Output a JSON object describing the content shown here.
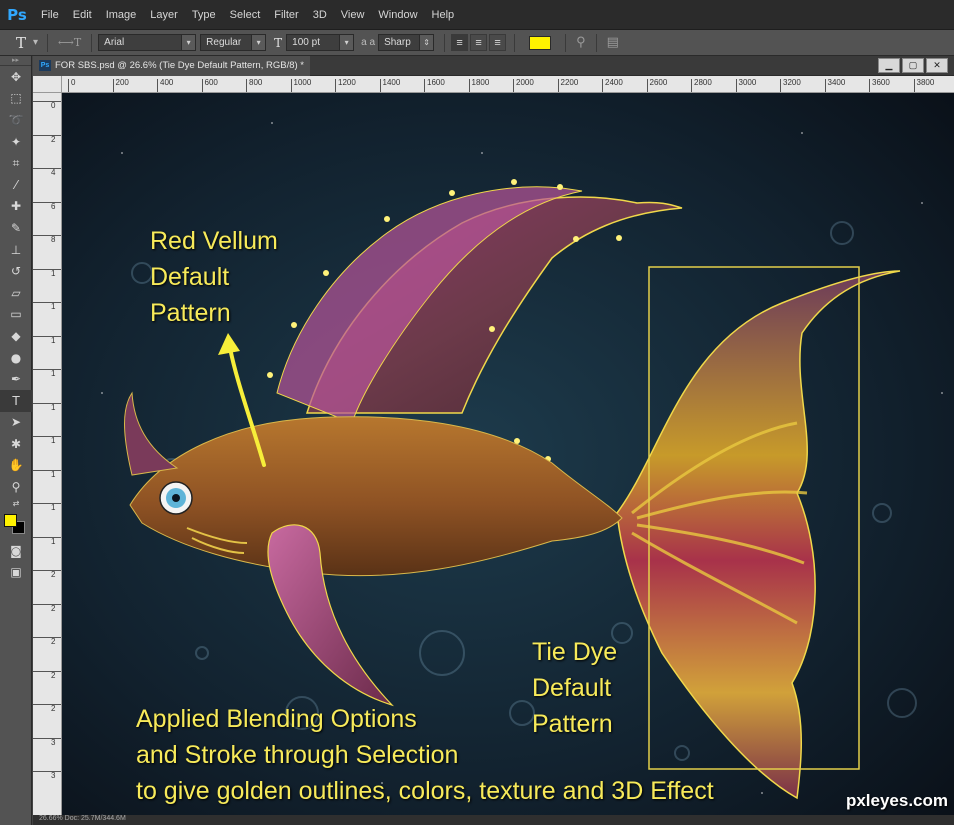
{
  "app": {
    "logo": "Ps"
  },
  "menu": [
    "File",
    "Edit",
    "Image",
    "Layer",
    "Type",
    "Select",
    "Filter",
    "3D",
    "View",
    "Window",
    "Help"
  ],
  "options": {
    "tool_glyph": "T",
    "orient_glyph": "⟷T",
    "font_family": "Arial",
    "font_style": "Regular",
    "size_glyph": "T",
    "font_size": "100 pt",
    "aa_glyph": "a a",
    "antialias": "Sharp",
    "text_color": "#fff200"
  },
  "document": {
    "tab_title": "FOR SBS.psd @ 26.6% (Tie Dye Default  Pattern, RGB/8) *",
    "win_buttons": [
      "▁",
      "▢",
      "✕"
    ],
    "ruler_h": [
      "0",
      "200",
      "400",
      "600",
      "800",
      "1000",
      "1200",
      "1400",
      "1600",
      "1800",
      "2000",
      "2200",
      "2400",
      "2600",
      "2800",
      "3000",
      "3200",
      "3400",
      "3600",
      "3800"
    ],
    "ruler_v": [
      "0",
      "2",
      "4",
      "6",
      "8",
      "1",
      "1",
      "1",
      "1",
      "1",
      "1",
      "1",
      "1",
      "1",
      "2",
      "2",
      "2",
      "2",
      "2",
      "3",
      "3"
    ],
    "status": "26.66%     Doc: 25.7M/344.6M"
  },
  "captions": {
    "red_vellum": "Red Vellum\nDefault\nPattern",
    "tie_dye": "Tie Dye\nDefault\nPattern",
    "applied": "Applied Blending Options\nand Stroke through Selection\nto give golden outlines, colors, texture and 3D Effect"
  },
  "watermark": "pxleyes.com",
  "colors": {
    "accent": "#f7ea5a",
    "foreground": "#fff200",
    "background": "#000000"
  }
}
